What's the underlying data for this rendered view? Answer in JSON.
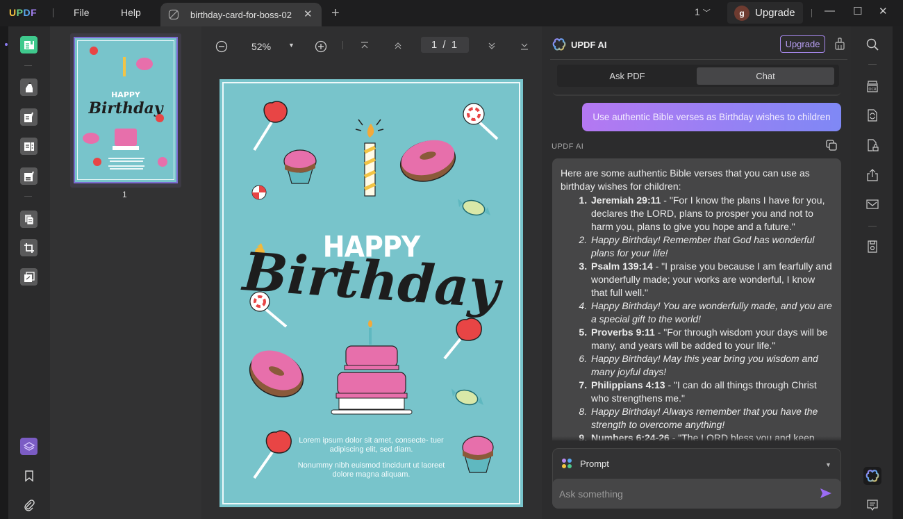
{
  "app": {
    "logo": [
      "U",
      "P",
      "D",
      "F"
    ],
    "menu": {
      "file": "File",
      "help": "Help"
    },
    "tab": {
      "title": "birthday-card-for-boss-02"
    },
    "page_selector": "1",
    "account": {
      "avatar_letter": "g",
      "upgrade_label": "Upgrade"
    }
  },
  "viewer": {
    "zoom": "52%",
    "page_indicator": "1 / 1",
    "thumbnail_page_number": "1"
  },
  "document": {
    "happy": "HAPPY",
    "birthday": "Birthday",
    "lorem1": "Lorem ipsum dolor sit amet, consecte- tuer adipiscing elit, sed diam.",
    "lorem2": "Nonummy nibh euismod tincidunt ut laoreet dolore magna aliquam.",
    "colors": {
      "background": "#78c4cb",
      "border": "#eef9fa"
    }
  },
  "ai_panel": {
    "title": "UPDF AI",
    "upgrade_label": "Upgrade",
    "tabs": [
      {
        "label": "Ask PDF",
        "active": false
      },
      {
        "label": "Chat",
        "active": true
      }
    ],
    "user_message": "Use authentic Bible verses as Birthday wishes to children",
    "assistant_label": "UPDF AI",
    "answer": {
      "intro": "Here are some authentic Bible verses that you can use as birthday wishes for children:",
      "items": [
        {
          "ref": "Jeremiah 29:11",
          "text": " - \"For I know the plans I have for you, declares the LORD, plans to prosper you and not to harm you, plans to give you hope and a future.\"",
          "italic": false
        },
        {
          "ref": "",
          "text": "Happy Birthday! Remember that God has wonderful plans for your life!",
          "italic": true
        },
        {
          "ref": "Psalm 139:14",
          "text": " - \"I praise you because I am fearfully and wonderfully made; your works are wonderful, I know that full well.\"",
          "italic": false
        },
        {
          "ref": "",
          "text": "Happy Birthday! You are wonderfully made, and you are a special gift to the world!",
          "italic": true
        },
        {
          "ref": "Proverbs 9:11",
          "text": " - \"For through wisdom your days will be many, and years will be added to your life.\"",
          "italic": false
        },
        {
          "ref": "",
          "text": "Happy Birthday! May this year bring you wisdom and many joyful days!",
          "italic": true
        },
        {
          "ref": "Philippians 4:13",
          "text": " - \"I can do all things through Christ who strengthens me.\"",
          "italic": false
        },
        {
          "ref": "",
          "text": "Happy Birthday! Always remember that you have the strength to overcome anything!",
          "italic": true
        },
        {
          "ref": "Numbers 6:24-26",
          "text": " - \"The LORD bless you and keep you;",
          "italic": false
        }
      ]
    },
    "prompt_label": "Prompt",
    "ask_placeholder": "Ask something",
    "colors": {
      "accent": "#a98af0",
      "bubble_start": "#b478f2",
      "bubble_end": "#7f88f5",
      "send": "#9b6cf5"
    }
  },
  "left_toolbar": {
    "items": [
      "reader",
      "highlighter",
      "edit-text",
      "page-layout",
      "fill-sign",
      "organize-pages",
      "crop",
      "watermark"
    ],
    "bottom": [
      "layers",
      "bookmark",
      "attachment"
    ]
  },
  "right_toolbar": {
    "items": [
      "search",
      "ocr",
      "convert",
      "protect",
      "share",
      "email",
      "save",
      "updf-ai",
      "comment"
    ]
  }
}
